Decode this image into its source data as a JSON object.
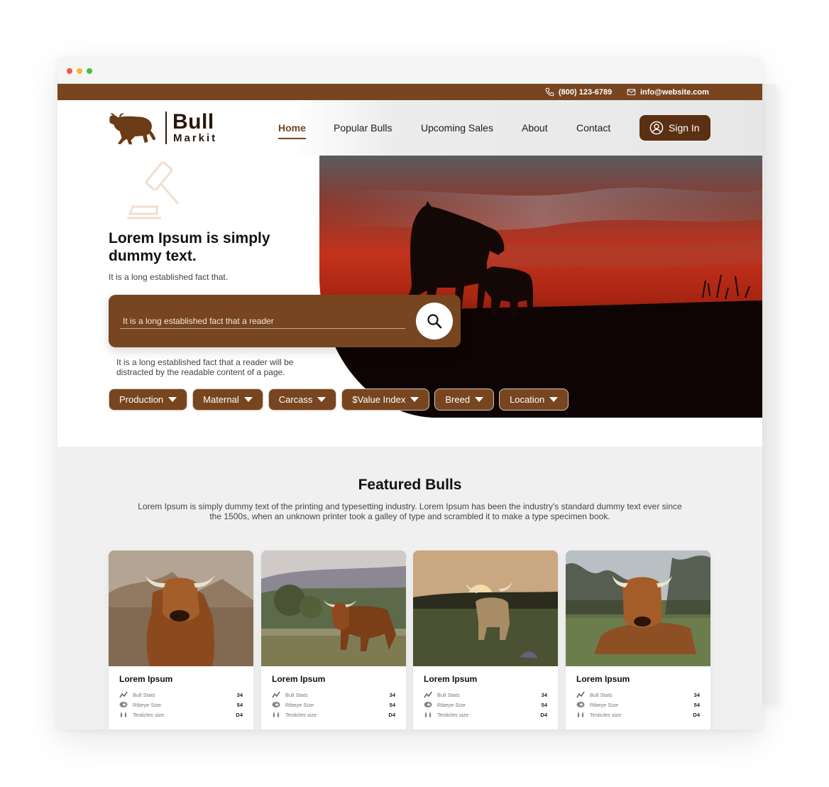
{
  "topbar": {
    "phone": "(800) 123-6789",
    "email": "info@website.com"
  },
  "logo": {
    "word1": "Bull",
    "word2": "Markit"
  },
  "nav": {
    "items": [
      "Home",
      "Popular Bulls",
      "Upcoming Sales",
      "About",
      "Contact"
    ],
    "active": "Home",
    "signin_label": "Sign In"
  },
  "hero": {
    "title": "Lorem Ipsum is simply dummy text.",
    "subtitle": "It is a long established fact that.",
    "search_placeholder": "It is a long established fact that a reader",
    "description": "It is a long established fact that a reader will be distracted by the readable content of a page.",
    "filters": [
      "Production",
      "Maternal",
      "Carcass",
      "$Value Index",
      "Breed",
      "Location"
    ]
  },
  "featured": {
    "title": "Featured Bulls",
    "description": "Lorem Ipsum is simply dummy text of the printing and typesetting industry. Lorem Ipsum has been the industry's standard dummy text ever since the 1500s, when an unknown printer took a galley of type and scrambled it to make a type specimen book.",
    "stat_labels": [
      "Bull Stats",
      "Ribeye Size",
      "Testicles size"
    ],
    "cards": [
      {
        "name": "Lorem Ipsum",
        "stats": [
          "34",
          "54",
          "D4"
        ]
      },
      {
        "name": "Lorem Ipsum",
        "stats": [
          "34",
          "54",
          "D4"
        ]
      },
      {
        "name": "Lorem Ipsum",
        "stats": [
          "34",
          "54",
          "D4"
        ]
      },
      {
        "name": "Lorem Ipsum",
        "stats": [
          "34",
          "54",
          "D4"
        ]
      }
    ]
  },
  "colors": {
    "brand": "#77451f",
    "brand_dark": "#5a2f12",
    "background_alt": "#f0f0f0"
  }
}
